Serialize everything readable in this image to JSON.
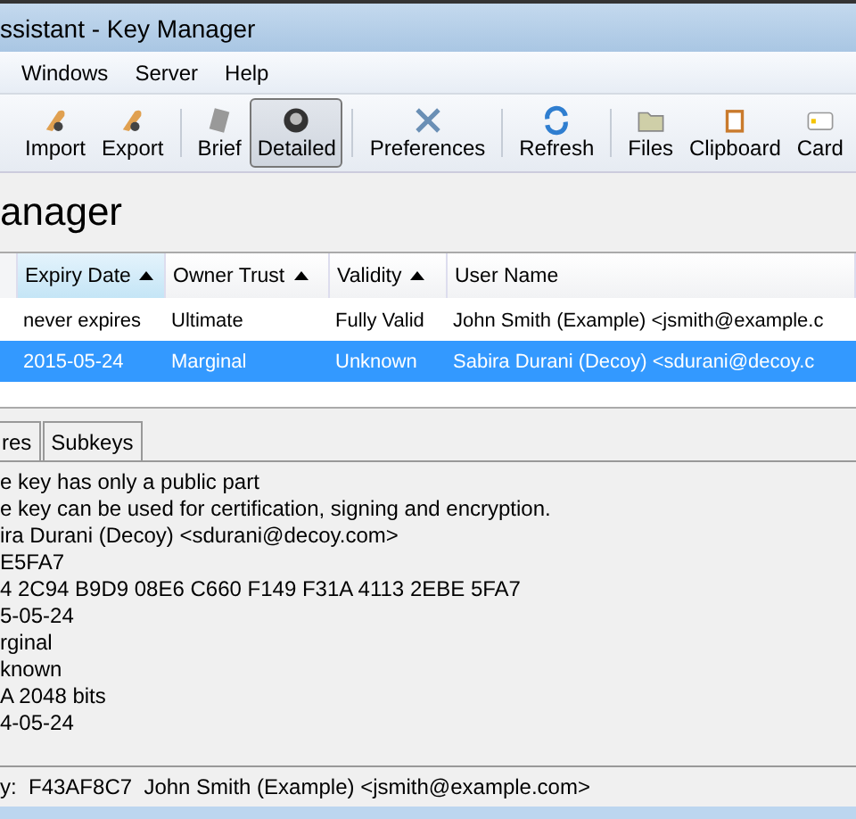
{
  "window": {
    "title": "ssistant - Key Manager"
  },
  "menu": [
    {
      "label": "Windows"
    },
    {
      "label": "Server"
    },
    {
      "label": "Help"
    }
  ],
  "toolbar": [
    {
      "label": "Import",
      "kind": "import",
      "selected": false,
      "separator_after": false
    },
    {
      "label": "Export",
      "kind": "export",
      "selected": false,
      "separator_after": true
    },
    {
      "label": "Brief",
      "kind": "brief",
      "selected": false,
      "separator_after": false
    },
    {
      "label": "Detailed",
      "kind": "detailed",
      "selected": true,
      "separator_after": true
    },
    {
      "label": "Preferences",
      "kind": "preferences",
      "selected": false,
      "separator_after": true
    },
    {
      "label": "Refresh",
      "kind": "refresh",
      "selected": false,
      "separator_after": true
    },
    {
      "label": "Files",
      "kind": "files",
      "selected": false,
      "separator_after": false
    },
    {
      "label": "Clipboard",
      "kind": "clipboard",
      "selected": false,
      "separator_after": false
    },
    {
      "label": "Card",
      "kind": "card",
      "selected": false,
      "separator_after": false
    }
  ],
  "heading": "anager",
  "table": {
    "columns": [
      {
        "label": "Expiry Date",
        "sorted": true,
        "arrow": true
      },
      {
        "label": "Owner Trust",
        "sorted": false,
        "arrow": true
      },
      {
        "label": "Validity",
        "sorted": false,
        "arrow": true
      },
      {
        "label": "User Name",
        "sorted": false,
        "arrow": false
      }
    ],
    "rows": [
      {
        "cells": [
          "never expires",
          "Ultimate",
          "Fully Valid",
          "John Smith (Example) <jsmith@example.c"
        ],
        "selected": false
      },
      {
        "cells": [
          "2015-05-24",
          "Marginal",
          "Unknown",
          "Sabira Durani (Decoy) <sdurani@decoy.c"
        ],
        "selected": true
      }
    ]
  },
  "tabs": [
    {
      "label": "res",
      "selected": false
    },
    {
      "label": "Subkeys",
      "selected": false
    }
  ],
  "details": [
    "e key has only a public part",
    "e key can be used for certification, signing and encryption.",
    "ira Durani (Decoy) <sdurani@decoy.com>",
    "E5FA7",
    "4 2C94 B9D9 08E6 C660  F149 F31A 4113 2EBE 5FA7",
    "5-05-24",
    "rginal",
    "known",
    "A 2048 bits",
    "4-05-24"
  ],
  "status_bar": "y:  F43AF8C7  John Smith (Example) <jsmith@example.com>"
}
